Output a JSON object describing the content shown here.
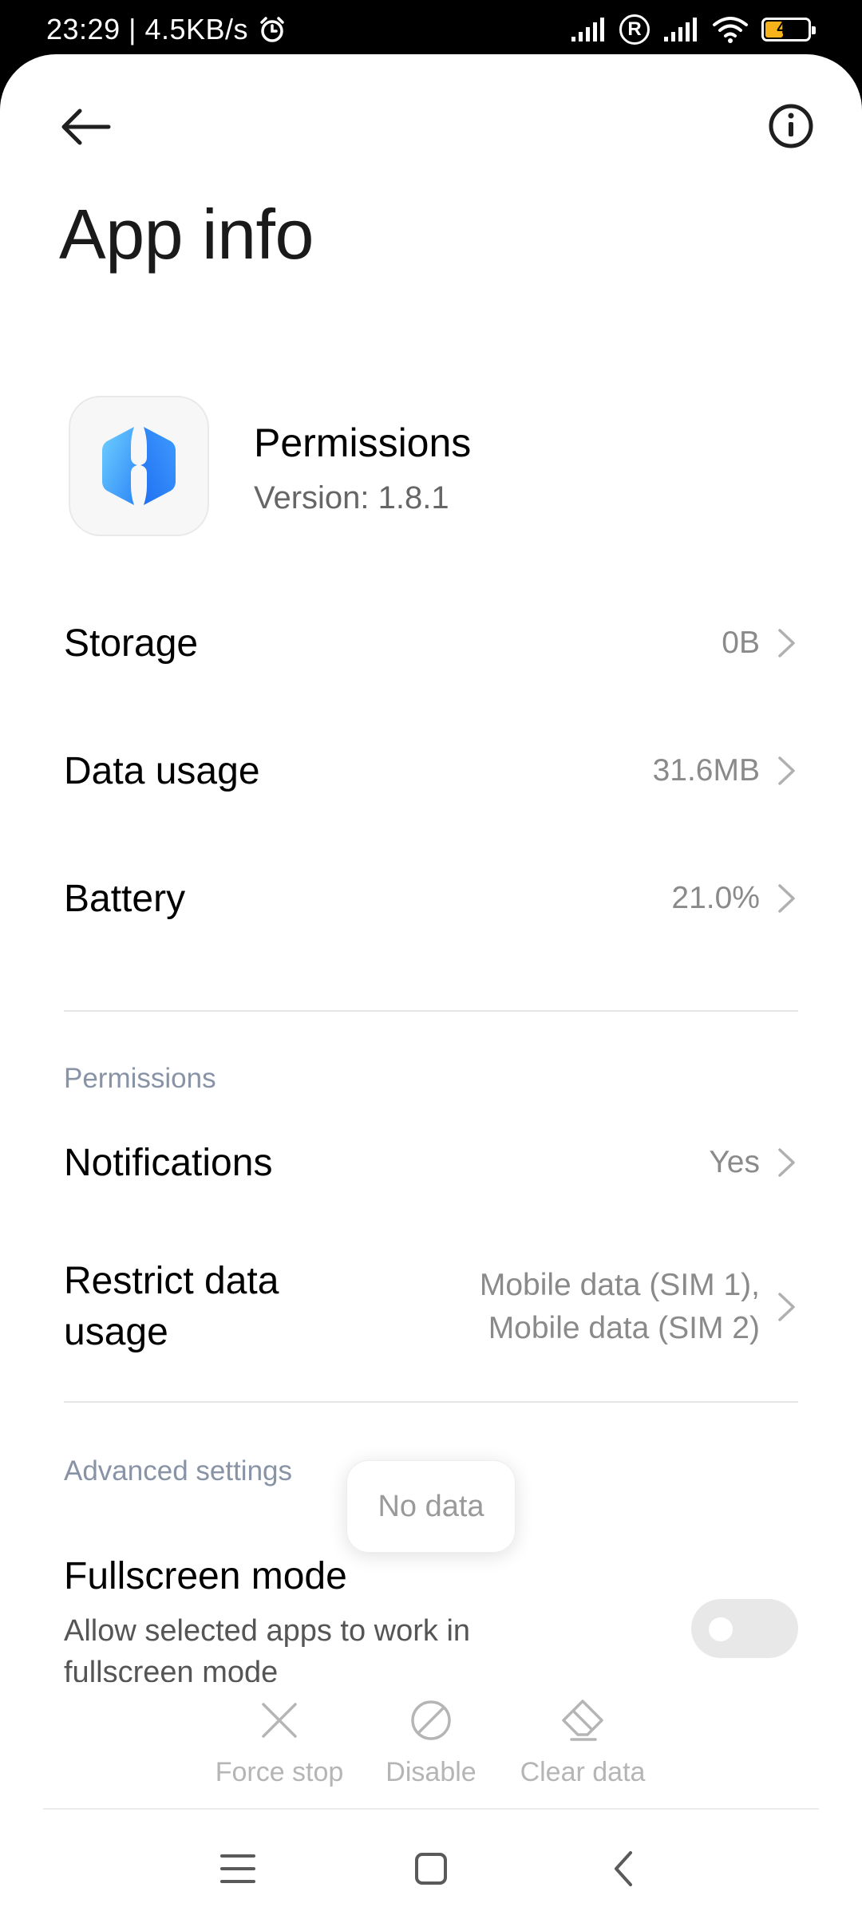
{
  "status_bar": {
    "time_speed": "23:29 | 4.5KB/s",
    "sim_badge": "R",
    "battery_level": "47",
    "battery_fraction": 0.47
  },
  "header": {
    "title": "App info",
    "back_icon": "arrow-left-icon",
    "info_icon": "info-circle-icon"
  },
  "app": {
    "name": "Permissions",
    "version": "Version: 1.8.1"
  },
  "rows": {
    "storage": {
      "label": "Storage",
      "value": "0B"
    },
    "data_usage": {
      "label": "Data usage",
      "value": "31.6MB"
    },
    "battery": {
      "label": "Battery",
      "value": "21.0%"
    }
  },
  "permissions": {
    "section_label": "Permissions",
    "notifications": {
      "label": "Notifications",
      "value": "Yes"
    },
    "restrict_data": {
      "label_line1": "Restrict data",
      "label_line2": "usage",
      "value_line1": "Mobile data (SIM 1),",
      "value_line2": "Mobile data (SIM 2)"
    }
  },
  "advanced": {
    "section_label": "Advanced settings",
    "fullscreen": {
      "title": "Fullscreen mode",
      "subtitle": "Allow selected apps to work in fullscreen mode",
      "enabled": false
    }
  },
  "toast": {
    "text": "No data"
  },
  "actions": {
    "force_stop": "Force stop",
    "disable": "Disable",
    "clear_data": "Clear data"
  },
  "colors": {
    "accent_section": "#8893a6",
    "battery_fill": "#f5b21a",
    "icon_blue_light": "#5bc6ff",
    "icon_blue_dark": "#2a7df5"
  }
}
